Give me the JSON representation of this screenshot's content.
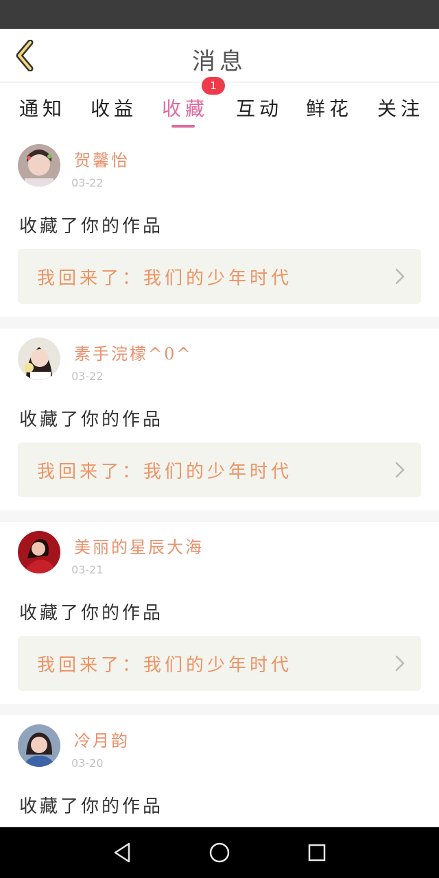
{
  "header": {
    "title": "消息",
    "back_icon": "chevron-left-icon"
  },
  "tabs": [
    {
      "label": "通知"
    },
    {
      "label": "收益"
    },
    {
      "label": "收藏",
      "active": true,
      "badge": "1"
    },
    {
      "label": "互动"
    },
    {
      "label": "鲜花"
    },
    {
      "label": "关注"
    }
  ],
  "feed": [
    {
      "username": "贺馨怡",
      "date": "03-22",
      "action": "收藏了你的作品",
      "work_title": "我回来了：我们的少年时代"
    },
    {
      "username": "素手浣檬^0^",
      "date": "03-22",
      "action": "收藏了你的作品",
      "work_title": "我回来了：我们的少年时代"
    },
    {
      "username": "美丽的星辰大海",
      "date": "03-21",
      "action": "收藏了你的作品",
      "work_title": "我回来了：我们的少年时代"
    },
    {
      "username": "冷月韵",
      "date": "03-20",
      "action": "收藏了你的作品",
      "work_title": ""
    }
  ],
  "nav": {
    "back": "triangle-back-icon",
    "home": "circle-home-icon",
    "recents": "square-recents-icon"
  },
  "colors": {
    "accent": "#e06aa0",
    "username": "#e9906b",
    "work_title": "#ec9467",
    "badge": "#ee3b4a"
  }
}
